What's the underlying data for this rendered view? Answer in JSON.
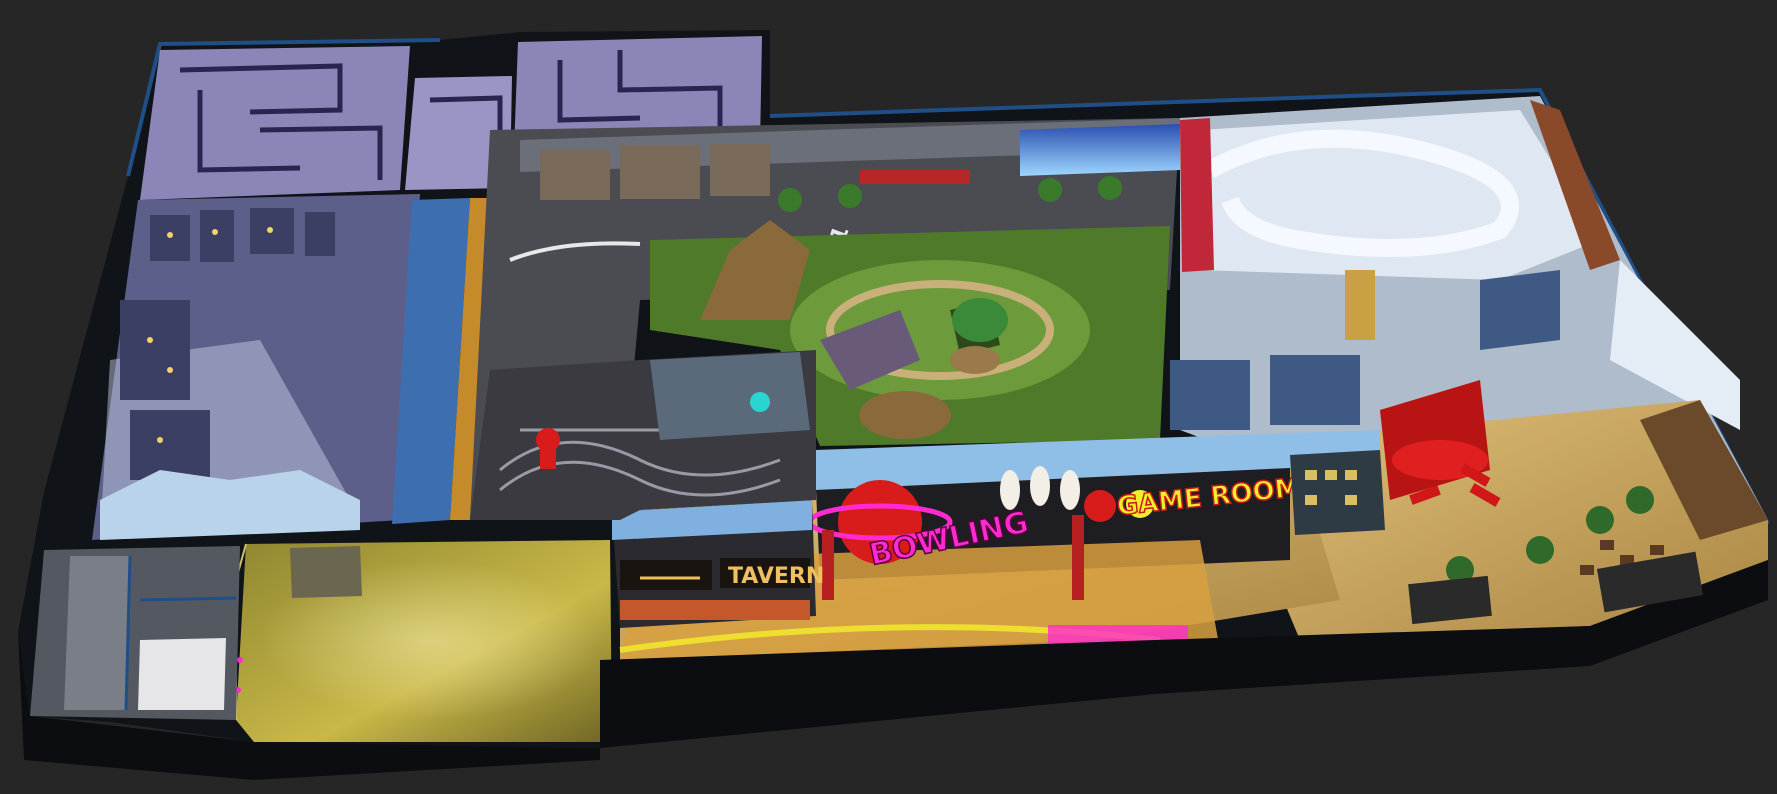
{
  "canvas": {
    "background": "#262626"
  },
  "signs": {
    "bowling": "BOWLING",
    "game_room": "GAME ROOM",
    "tavern": "TAVERN",
    "street_marking": "NY1"
  },
  "colors": {
    "wall_dark": "#101418",
    "wall_trim": "#1f4f86",
    "maze": "#8c86b8",
    "haunted_town": "#5c5f8a",
    "city_floor": "#4a4c52",
    "jungle": "#4f7a2a",
    "ice_zone": "#aebccc",
    "sand": "#c8a765",
    "bowling_floor": "#d8a040",
    "lobby": "#b7a63a",
    "neon_pink": "#ff2bd0",
    "neon_yellow": "#f2ee2a",
    "neon_green": "#54ff3a",
    "sign_red": "#d81b1b"
  }
}
